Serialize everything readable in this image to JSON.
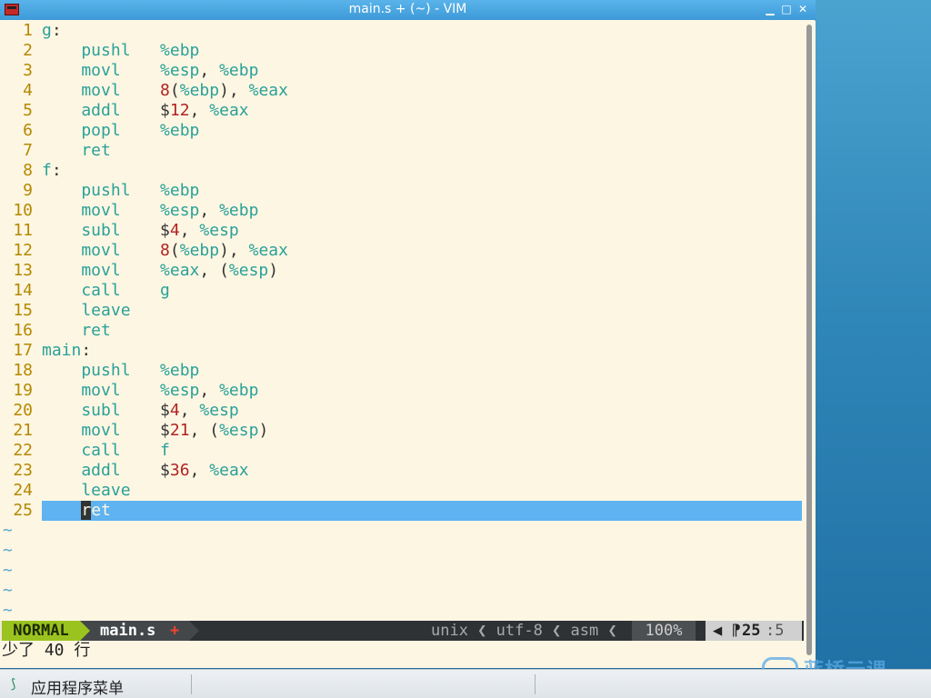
{
  "window": {
    "title": "main.s + (~) - VIM",
    "buttons": {
      "minimize": "▁",
      "maximize": "□",
      "close": "✕"
    }
  },
  "editor": {
    "lines": [
      {
        "n": "1",
        "tokens": [
          [
            "lbl",
            "g"
          ],
          [
            "pun",
            ":"
          ]
        ]
      },
      {
        "n": "2",
        "tokens": [
          [
            "ins",
            "    pushl   "
          ],
          [
            "reg",
            "%ebp"
          ]
        ]
      },
      {
        "n": "3",
        "tokens": [
          [
            "ins",
            "    movl    "
          ],
          [
            "reg",
            "%esp"
          ],
          [
            "pun",
            ", "
          ],
          [
            "reg",
            "%ebp"
          ]
        ]
      },
      {
        "n": "4",
        "tokens": [
          [
            "ins",
            "    movl    "
          ],
          [
            "num",
            "8"
          ],
          [
            "pun",
            "("
          ],
          [
            "reg",
            "%ebp"
          ],
          [
            "pun",
            "), "
          ],
          [
            "reg",
            "%eax"
          ]
        ]
      },
      {
        "n": "5",
        "tokens": [
          [
            "ins",
            "    addl    "
          ],
          [
            "pun",
            "$"
          ],
          [
            "num",
            "12"
          ],
          [
            "pun",
            ", "
          ],
          [
            "reg",
            "%eax"
          ]
        ]
      },
      {
        "n": "6",
        "tokens": [
          [
            "ins",
            "    popl    "
          ],
          [
            "reg",
            "%ebp"
          ]
        ]
      },
      {
        "n": "7",
        "tokens": [
          [
            "ins",
            "    ret"
          ]
        ]
      },
      {
        "n": "8",
        "tokens": [
          [
            "lbl",
            "f"
          ],
          [
            "pun",
            ":"
          ]
        ]
      },
      {
        "n": "9",
        "tokens": [
          [
            "ins",
            "    pushl   "
          ],
          [
            "reg",
            "%ebp"
          ]
        ]
      },
      {
        "n": "10",
        "tokens": [
          [
            "ins",
            "    movl    "
          ],
          [
            "reg",
            "%esp"
          ],
          [
            "pun",
            ", "
          ],
          [
            "reg",
            "%ebp"
          ]
        ]
      },
      {
        "n": "11",
        "tokens": [
          [
            "ins",
            "    subl    "
          ],
          [
            "pun",
            "$"
          ],
          [
            "num",
            "4"
          ],
          [
            "pun",
            ", "
          ],
          [
            "reg",
            "%esp"
          ]
        ]
      },
      {
        "n": "12",
        "tokens": [
          [
            "ins",
            "    movl    "
          ],
          [
            "num",
            "8"
          ],
          [
            "pun",
            "("
          ],
          [
            "reg",
            "%ebp"
          ],
          [
            "pun",
            "), "
          ],
          [
            "reg",
            "%eax"
          ]
        ]
      },
      {
        "n": "13",
        "tokens": [
          [
            "ins",
            "    movl    "
          ],
          [
            "reg",
            "%eax"
          ],
          [
            "pun",
            ", ("
          ],
          [
            "reg",
            "%esp"
          ],
          [
            "pun",
            ")"
          ]
        ]
      },
      {
        "n": "14",
        "tokens": [
          [
            "ins",
            "    call    "
          ],
          [
            "tgt",
            "g"
          ]
        ]
      },
      {
        "n": "15",
        "tokens": [
          [
            "ins",
            "    leave"
          ]
        ]
      },
      {
        "n": "16",
        "tokens": [
          [
            "ins",
            "    ret"
          ]
        ]
      },
      {
        "n": "17",
        "tokens": [
          [
            "lbl",
            "main"
          ],
          [
            "pun",
            ":"
          ]
        ]
      },
      {
        "n": "18",
        "tokens": [
          [
            "ins",
            "    pushl   "
          ],
          [
            "reg",
            "%ebp"
          ]
        ]
      },
      {
        "n": "19",
        "tokens": [
          [
            "ins",
            "    movl    "
          ],
          [
            "reg",
            "%esp"
          ],
          [
            "pun",
            ", "
          ],
          [
            "reg",
            "%ebp"
          ]
        ]
      },
      {
        "n": "20",
        "tokens": [
          [
            "ins",
            "    subl    "
          ],
          [
            "pun",
            "$"
          ],
          [
            "num",
            "4"
          ],
          [
            "pun",
            ", "
          ],
          [
            "reg",
            "%esp"
          ]
        ]
      },
      {
        "n": "21",
        "tokens": [
          [
            "ins",
            "    movl    "
          ],
          [
            "pun",
            "$"
          ],
          [
            "num",
            "21"
          ],
          [
            "pun",
            ", ("
          ],
          [
            "reg",
            "%esp"
          ],
          [
            "pun",
            ")"
          ]
        ]
      },
      {
        "n": "22",
        "tokens": [
          [
            "ins",
            "    call    "
          ],
          [
            "tgt",
            "f"
          ]
        ]
      },
      {
        "n": "23",
        "tokens": [
          [
            "ins",
            "    addl    "
          ],
          [
            "pun",
            "$"
          ],
          [
            "num",
            "36"
          ],
          [
            "pun",
            ", "
          ],
          [
            "reg",
            "%eax"
          ]
        ]
      },
      {
        "n": "24",
        "tokens": [
          [
            "ins",
            "    leave"
          ]
        ]
      },
      {
        "n": "25",
        "current": true,
        "pre": "    ",
        "cursor": "r",
        "post": "et"
      }
    ],
    "tilde": "~",
    "tilde_count": 5
  },
  "statusline": {
    "mode": "NORMAL",
    "filename": "main.s",
    "modified": "+",
    "info": "unix ❮ utf-8 ❮ asm ❮",
    "percent": "100%",
    "line_icon": "◀ ⁋",
    "line": "25",
    "col": ":5"
  },
  "cmdline": "少了 40 行",
  "taskbar": {
    "menu_label": "应用程序菜单"
  },
  "watermark": {
    "text": "蓝桥云课"
  }
}
